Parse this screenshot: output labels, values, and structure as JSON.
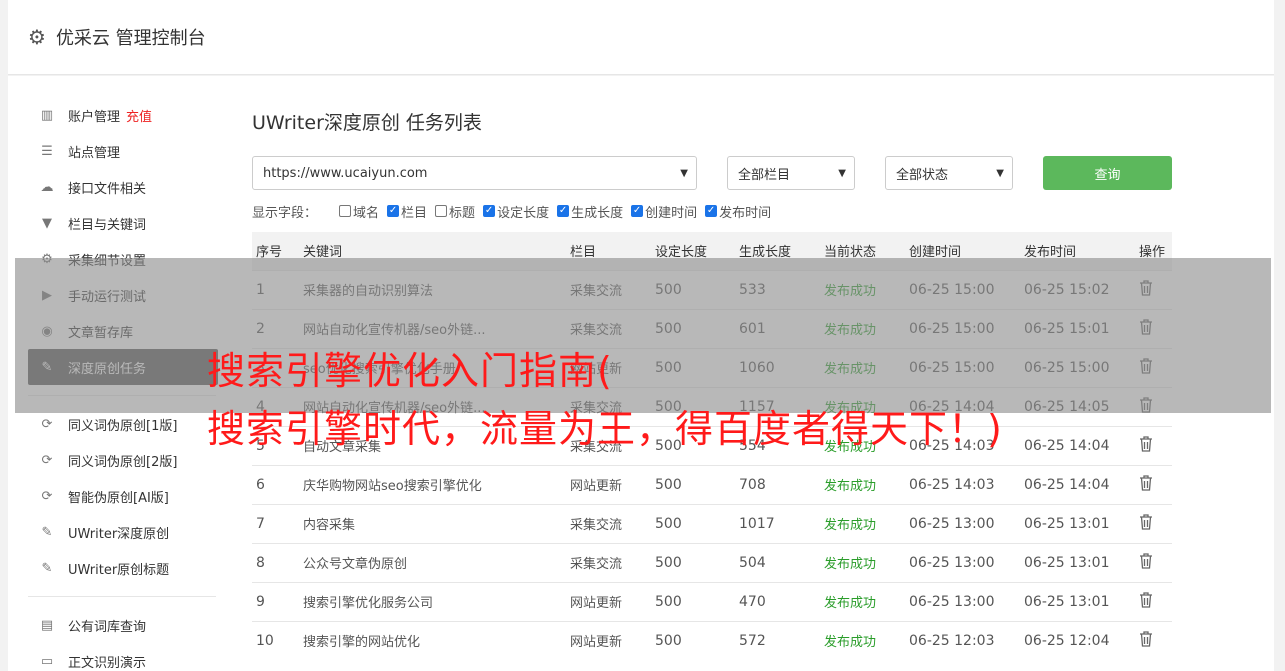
{
  "header": {
    "title": "优采云 管理控制台",
    "icon": "gear-icon"
  },
  "sidebar": {
    "items": [
      {
        "label": "账户管理",
        "icon": "bar-chart-icon",
        "extra": "充值"
      },
      {
        "label": "站点管理",
        "icon": "server-icon"
      },
      {
        "label": "接口文件相关",
        "icon": "cloud-upload-icon"
      },
      {
        "label": "栏目与关键词",
        "icon": "filter-icon"
      },
      {
        "label": "采集细节设置",
        "icon": "cogs-icon"
      },
      {
        "label": "手动运行测试",
        "icon": "play-icon"
      },
      {
        "label": "文章暂存库",
        "icon": "database-icon"
      },
      {
        "label": "深度原创任务",
        "icon": "edit-icon"
      },
      {
        "label": "同义词伪原创[1版]",
        "icon": "refresh-icon"
      },
      {
        "label": "同义词伪原创[2版]",
        "icon": "refresh-icon"
      },
      {
        "label": "智能伪原创[AI版]",
        "icon": "refresh-icon"
      },
      {
        "label": "UWriter深度原创",
        "icon": "edit-icon"
      },
      {
        "label": "UWriter原创标题",
        "icon": "edit-icon"
      },
      {
        "label": "公有词库查询",
        "icon": "book-icon"
      },
      {
        "label": "正文识别演示",
        "icon": "monitor-icon"
      }
    ]
  },
  "main": {
    "title": "UWriter深度原创 任务列表",
    "site_select": "https://www.ucaiyun.com",
    "column_select": "全部栏目",
    "status_select": "全部状态",
    "query_label": "查询",
    "fields_label": "显示字段：",
    "fields": [
      {
        "label": "域名",
        "checked": false
      },
      {
        "label": "栏目",
        "checked": true
      },
      {
        "label": "标题",
        "checked": false
      },
      {
        "label": "设定长度",
        "checked": true
      },
      {
        "label": "生成长度",
        "checked": true
      },
      {
        "label": "创建时间",
        "checked": true
      },
      {
        "label": "发布时间",
        "checked": true
      }
    ],
    "table": {
      "headers": [
        "序号",
        "关键词",
        "栏目",
        "设定长度",
        "生成长度",
        "当前状态",
        "创建时间",
        "发布时间",
        "操作"
      ],
      "rows": [
        [
          "1",
          "采集器的自动识别算法",
          "采集交流",
          "500",
          "533",
          "发布成功",
          "06-25 15:00",
          "06-25 15:02"
        ],
        [
          "2",
          "网站自动化宣传机器/seo外链...",
          "采集交流",
          "500",
          "601",
          "发布成功",
          "06-25 15:00",
          "06-25 15:01"
        ],
        [
          "3",
          "seo优化搜索引擎优化手册",
          "网站更新",
          "500",
          "1060",
          "发布成功",
          "06-25 15:00",
          "06-25 15:00"
        ],
        [
          "4",
          "网站自动化宣传机器/seo外链...",
          "采集交流",
          "500",
          "1157",
          "发布成功",
          "06-25 14:04",
          "06-25 14:05"
        ],
        [
          "5",
          "自动文章采集",
          "采集交流",
          "500",
          "554",
          "发布成功",
          "06-25 14:03",
          "06-25 14:04"
        ],
        [
          "6",
          "庆华购物网站seo搜索引擎优化",
          "网站更新",
          "500",
          "708",
          "发布成功",
          "06-25 14:03",
          "06-25 14:04"
        ],
        [
          "7",
          "内容采集",
          "采集交流",
          "500",
          "1017",
          "发布成功",
          "06-25 13:00",
          "06-25 13:01"
        ],
        [
          "8",
          "公众号文章伪原创",
          "采集交流",
          "500",
          "504",
          "发布成功",
          "06-25 13:00",
          "06-25 13:01"
        ],
        [
          "9",
          "搜索引擎优化服务公司",
          "网站更新",
          "500",
          "470",
          "发布成功",
          "06-25 13:00",
          "06-25 13:01"
        ],
        [
          "10",
          "搜索引擎的网站优化",
          "网站更新",
          "500",
          "572",
          "发布成功",
          "06-25 12:03",
          "06-25 12:04"
        ]
      ]
    }
  },
  "overlay": {
    "line1": "搜索引擎优化入门指南(",
    "line2": "搜索引擎时代，流量为王，得百度者得天下！)"
  }
}
